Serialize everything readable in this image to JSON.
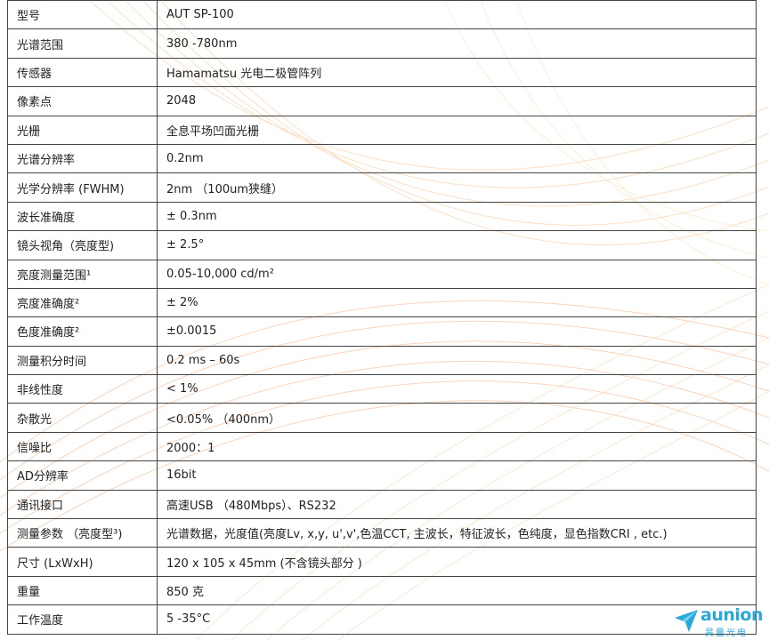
{
  "specs": [
    {
      "label": "型号",
      "value": "AUT SP-100"
    },
    {
      "label": "光谱范围",
      "value": "380 -780nm"
    },
    {
      "label": "传感器",
      "value": "Hamamatsu 光电二极管阵列"
    },
    {
      "label": "像素点",
      "value": "2048"
    },
    {
      "label": "光栅",
      "value": "全息平场凹面光栅"
    },
    {
      "label": "光谱分辨率",
      "value": "0.2nm"
    },
    {
      "label": "光学分辨率 (FWHM)",
      "value": "2nm （100um狭缝）"
    },
    {
      "label": "波长准确度",
      "value": "± 0.3nm"
    },
    {
      "label": "镜头视角（亮度型)",
      "value": "± 2.5°"
    },
    {
      "label": "亮度测量范围¹",
      "value": "0.05-10,000 cd/m²"
    },
    {
      "label": "亮度准确度²",
      "value": "± 2%"
    },
    {
      "label": "色度准确度²",
      "value": "±0.0015"
    },
    {
      "label": "测量积分时间",
      "value": "0.2 ms – 60s"
    },
    {
      "label": "非线性度",
      "value": "< 1%"
    },
    {
      "label": "杂散光",
      "value": "<0.05% （400nm）"
    },
    {
      "label": "信噪比",
      "value": "2000：1"
    },
    {
      "label": "AD分辨率",
      "value": "16bit"
    },
    {
      "label": "通讯接口",
      "value": "高速USB （480Mbps）、RS232"
    },
    {
      "label": "测量参数 （亮度型³)",
      "value": "光谱数据，光度值(亮度Lv, x,y, u',v',色温CCT, 主波长，特征波长，色纯度，显色指数CRI , etc.)"
    },
    {
      "label": "尺寸 (LxWxH)",
      "value": "120 x 105 x 45mm (不含镜头部分 )"
    },
    {
      "label": "重量",
      "value": "850 克"
    },
    {
      "label": "工作温度",
      "value": "5 -35°C"
    }
  ],
  "logo": {
    "name": "aunion",
    "subtitle": "昊量光电",
    "color": "#2aa8d8"
  },
  "colors": {
    "wave_light": "#fde6c4",
    "wave_mid": "#f7b987",
    "wave_dark": "#f09a6a",
    "border": "#444444"
  }
}
